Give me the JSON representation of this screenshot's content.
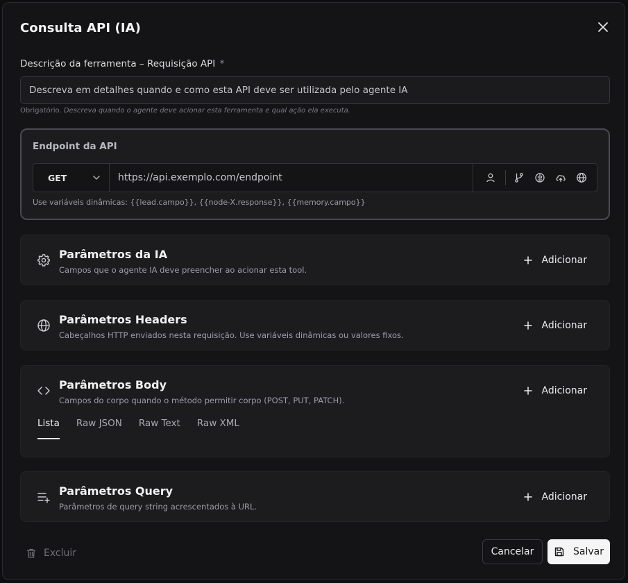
{
  "modal": {
    "title": "Consulta API (IA)"
  },
  "description": {
    "label": "Descrição da ferramenta – Requisição API",
    "required_mark": "*",
    "placeholder": "Descreva em detalhes quando e como esta API deve ser utilizada pelo agente IA",
    "hint_prefix": "Obrigatório.",
    "hint_text": "Descreva quando o agente deve acionar esta ferramenta e qual ação ela executa."
  },
  "endpoint": {
    "title": "Endpoint da API",
    "method": "GET",
    "url_placeholder": "https://api.exemplo.com/endpoint",
    "hint": "Use variáveis dinâmicas: {{lead.campo}}, {{node-X.response}}, {{memory.campo}}",
    "tool_icons": [
      "user-icon",
      "git-branch-icon",
      "brain-icon",
      "cloud-upload-icon",
      "globe-icon"
    ]
  },
  "sections": {
    "ia": {
      "title": "Parâmetros da IA",
      "subtitle": "Campos que o agente IA deve preencher ao acionar esta tool.",
      "icon": "gear-icon",
      "add_label": "Adicionar"
    },
    "headers": {
      "title": "Parâmetros Headers",
      "subtitle": "Cabeçalhos HTTP enviados nesta requisição. Use variáveis dinâmicas ou valores fixos.",
      "icon": "globe-icon",
      "add_label": "Adicionar"
    },
    "body": {
      "title": "Parâmetros Body",
      "subtitle": "Campos do corpo quando o método permitir corpo (POST, PUT, PATCH).",
      "icon": "code-icon",
      "add_label": "Adicionar",
      "tabs": [
        "Lista",
        "Raw JSON",
        "Raw Text",
        "Raw XML"
      ],
      "active_tab": "Lista"
    },
    "query": {
      "title": "Parâmetros Query",
      "subtitle": "Parâmetros de query string acrescentados à URL.",
      "icon": "list-plus-icon",
      "add_label": "Adicionar"
    }
  },
  "footer": {
    "delete_label": "Excluir",
    "cancel_label": "Cancelar",
    "save_label": "Salvar"
  },
  "colors": {
    "background": "#141416",
    "card": "#1c1c1f",
    "primary_button": "#f5f5f6"
  }
}
